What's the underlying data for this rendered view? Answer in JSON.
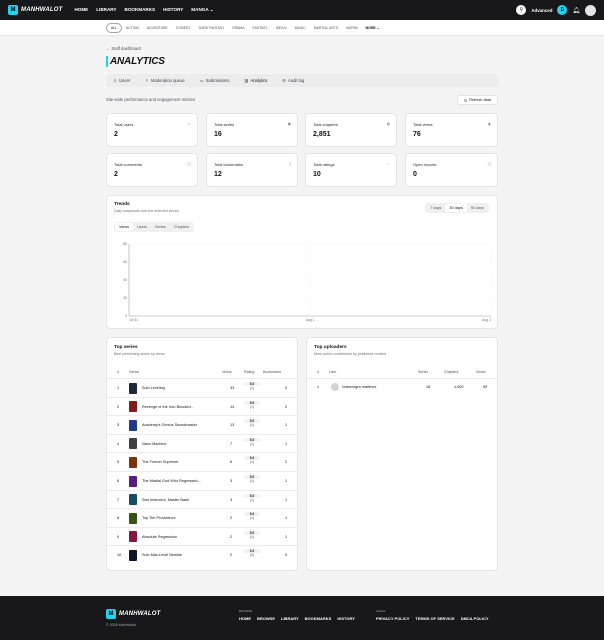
{
  "app": {
    "brand": "MANHWALOT",
    "search_label": "Advanced",
    "profile_initial": "D"
  },
  "nav": [
    "HOME",
    "LIBRARY",
    "BOOKMARKS",
    "HISTORY",
    "MANGA"
  ],
  "categories": [
    "ALL",
    "ACTION",
    "ADVENTURE",
    "COMEDY",
    "DARK FANTASY",
    "DRAMA",
    "FANTASY",
    "ISEKAI",
    "MAGIC",
    "MARTIAL ARTS",
    "MURIM",
    "MORE"
  ],
  "page": {
    "back": "Staff dashboard",
    "title": "ANALYTICS",
    "subtitle": "Site-wide performance and engagement metrics",
    "refresh": "Refresh data"
  },
  "tabs": [
    "Users",
    "Moderation queue",
    "Submissions",
    "Analytics",
    "Audit log"
  ],
  "stats": [
    {
      "label": "Total users",
      "value": "2"
    },
    {
      "label": "Total series",
      "value": "16"
    },
    {
      "label": "Total chapters",
      "value": "2,851"
    },
    {
      "label": "Total views",
      "value": "76"
    },
    {
      "label": "Total comments",
      "value": "2"
    },
    {
      "label": "Total bookmarks",
      "value": "12"
    },
    {
      "label": "Total ratings",
      "value": "10"
    },
    {
      "label": "Open reports",
      "value": "0"
    }
  ],
  "trends": {
    "title": "Trends",
    "subtitle": "Daily snapshots over the selected period",
    "ranges": [
      "7 days",
      "30 days",
      "90 days"
    ],
    "metrics": [
      "Views",
      "Users",
      "Series",
      "Chapters"
    ]
  },
  "chart_data": {
    "type": "line",
    "title": "",
    "x": [
      "Jul 31",
      "Aug 1",
      "Aug 2"
    ],
    "ylim": [
      0,
      80
    ],
    "yticks": [
      "0",
      "20",
      "40",
      "60",
      "80"
    ],
    "series": [
      {
        "values": []
      }
    ]
  },
  "top_series": {
    "title": "Top series",
    "subtitle": "Best performing series by views",
    "headers": [
      "#",
      "Series",
      "Views",
      "Rating",
      "Bookmarks"
    ],
    "rows": [
      {
        "rank": "1",
        "name": "Solo Leveling",
        "views": "33",
        "rating": "5.0",
        "count": "(1)",
        "bookmarks": "0",
        "color": "#1e293b"
      },
      {
        "rank": "2",
        "name": "Revenge of the Iron-Blooded...",
        "views": "14",
        "rating": "5.0",
        "count": "(1)",
        "bookmarks": "2",
        "color": "#7f1d1d"
      },
      {
        "rank": "3",
        "name": "Academy's Genius Swordmaster",
        "views": "13",
        "rating": "5.0",
        "count": "(1)",
        "bookmarks": "1",
        "color": "#1e3a8a"
      },
      {
        "rank": "4",
        "name": "Nano Machine",
        "views": "7",
        "rating": "5.0",
        "count": "(1)",
        "bookmarks": "1",
        "color": "#3f3f46"
      },
      {
        "rank": "5",
        "name": "The Former Supreme",
        "views": "6",
        "rating": "5.0",
        "count": "(1)",
        "bookmarks": "2",
        "color": "#78350f"
      },
      {
        "rank": "6",
        "name": "The Martial God Who Regressed...",
        "views": "3",
        "rating": "5.0",
        "count": "(1)",
        "bookmarks": "1",
        "color": "#581c87"
      },
      {
        "rank": "7",
        "name": "Star Instructor, Master Baek",
        "views": "3",
        "rating": "5.0",
        "count": "(1)",
        "bookmarks": "1",
        "color": "#164e63"
      },
      {
        "rank": "8",
        "name": "Top Tier Providence",
        "views": "2",
        "rating": "5.0",
        "count": "(1)",
        "bookmarks": "1",
        "color": "#365314"
      },
      {
        "rank": "9",
        "name": "Absolute Regression",
        "views": "2",
        "rating": "5.0",
        "count": "(1)",
        "bookmarks": "1",
        "color": "#831843"
      },
      {
        "rank": "10",
        "name": "Solo Max-Level Newbie",
        "views": "2",
        "rating": "0.0",
        "count": "(0)",
        "bookmarks": "0",
        "color": "#0f172a"
      }
    ]
  },
  "top_uploaders": {
    "title": "Top uploaders",
    "subtitle": "Most active contributors by published content",
    "headers": [
      "#",
      "User",
      "Series",
      "Chapters",
      "Views"
    ],
    "rows": [
      {
        "rank": "1",
        "name": "Nubenegra martinez",
        "series": "16",
        "chapters": "1,000",
        "views": "89"
      }
    ]
  },
  "footer": {
    "brand": "MANHWALOT",
    "copyright": "© 2026 Manhwalot",
    "browse_label": "BROWSE",
    "browse": [
      "HOME",
      "BROWSE",
      "LIBRARY",
      "BOOKMARKS",
      "HISTORY"
    ],
    "legal_label": "LEGAL",
    "legal": [
      "PRIVACY POLICY",
      "TERMS OF SERVICE",
      "DMCA POLICY"
    ]
  }
}
